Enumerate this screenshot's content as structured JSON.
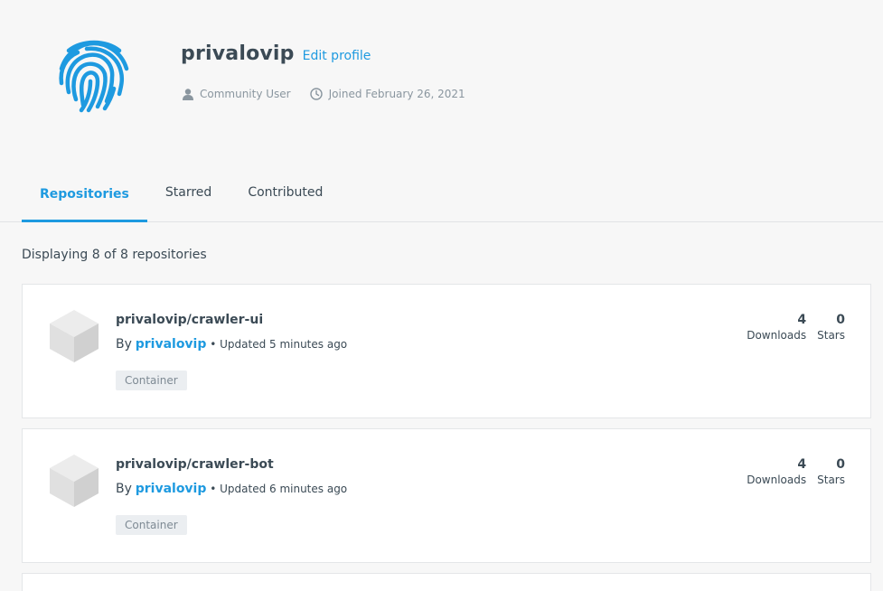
{
  "profile": {
    "username": "privalovip",
    "edit_label": "Edit profile",
    "role": "Community User",
    "joined": "Joined February 26, 2021"
  },
  "tabs": [
    {
      "label": "Repositories",
      "active": true
    },
    {
      "label": "Starred",
      "active": false
    },
    {
      "label": "Contributed",
      "active": false
    }
  ],
  "repositories": {
    "count_text": "Displaying 8 of 8 repositories",
    "items": [
      {
        "name": "privalovip/crawler-ui",
        "by": "By",
        "author": "privalovip",
        "updated": "• Updated 5 minutes ago",
        "tag": "Container",
        "downloads": "4",
        "downloads_label": "Downloads",
        "stars": "0",
        "stars_label": "Stars"
      },
      {
        "name": "privalovip/crawler-bot",
        "by": "By",
        "author": "privalovip",
        "updated": "• Updated 6 minutes ago",
        "tag": "Container",
        "downloads": "4",
        "downloads_label": "Downloads",
        "stars": "0",
        "stars_label": "Stars"
      }
    ]
  },
  "colors": {
    "accent": "#1e9ae0",
    "text": "#3b4a55",
    "muted": "#8a969f",
    "background": "#f7f7f7"
  },
  "icons": {
    "avatar": "fingerprint-icon",
    "role": "user-icon",
    "joined": "clock-icon",
    "repo": "cube-icon"
  }
}
